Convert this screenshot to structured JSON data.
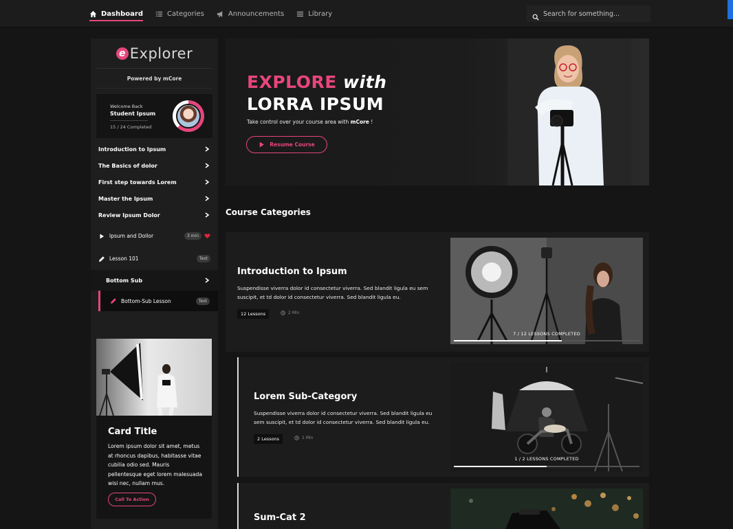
{
  "nav": {
    "items": [
      {
        "label": "Dashboard",
        "icon": "home-icon"
      },
      {
        "label": "Categories",
        "icon": "list-icon"
      },
      {
        "label": "Announcements",
        "icon": "megaphone-icon"
      },
      {
        "label": "Library",
        "icon": "library-icon"
      }
    ],
    "search_placeholder": "Search for something..."
  },
  "sidebar": {
    "logo_text": "Explorer",
    "logo_mark": "e",
    "powered_by": "Powered by mCore",
    "welcome": {
      "greeting": "Welcome Back",
      "name": "Student Ipsum",
      "progress_text": "15 / 24 Completed",
      "progress_fraction": 0.625
    },
    "menu": [
      {
        "label": "Introduction to Ipsum"
      },
      {
        "label": "The Basics of dolor"
      },
      {
        "label": "First step towards Lorem"
      },
      {
        "label": "Master the Ipsum"
      },
      {
        "label": "Review Ipsum Dolor"
      }
    ],
    "lessons": [
      {
        "label": "Ipsum and Dollor",
        "badge": "3 min",
        "icon": "play-icon",
        "favorite": true
      },
      {
        "label": "Lesson 101",
        "badge": "Text",
        "icon": "pencil-icon"
      }
    ],
    "sub": {
      "label": "Bottom Sub"
    },
    "sub_lesson": {
      "label": "Bottom-Sub Lesson",
      "badge": "Text",
      "icon": "pencil-icon"
    },
    "card": {
      "title": "Card Title",
      "body": "Lorem ipsum dolor sit amet, metus at rhoncus dapibus, habitasse vitae cubilia odio sed. Mauris pellentesque eget lorem malesuada wisi nec, nullam mus.",
      "cta": "Call To Action"
    }
  },
  "hero": {
    "title_highlight": "EXPLORE",
    "title_italic": "with",
    "title_line2": "LORRA IPSUM",
    "subtitle_pre": "Take control over your course area with",
    "subtitle_brand": "mCore",
    "subtitle_post": "!",
    "button": "Resume Course"
  },
  "section_title": "Course Categories",
  "categories": [
    {
      "title": "Introduction to Ipsum",
      "desc": "Suspendisse viverra dolor id consectetur viverra. Sed blandit ligula eu sem suscipit, et td dolor id consectetur viverra. Sed blandit ligula eu.",
      "lessons": "12 Lessons",
      "time": "2 Min",
      "progress_text": "7 / 12  LESSONS COMPLETED",
      "progress_fraction": 0.5833
    },
    {
      "title": "Lorem Sub-Category",
      "desc": "Suspendisse viverra dolor id consectetur viverra. Sed blandit ligula eu sem suscipit, et td dolor id consectetur viverra. Sed blandit ligula eu.",
      "lessons": "2 Lessons",
      "time": "1 Min",
      "progress_text": "1 / 2  LESSONS COMPLETED",
      "progress_fraction": 0.5
    },
    {
      "title": "Sum-Cat 2"
    }
  ],
  "colors": {
    "accent": "#e6467c",
    "background": "#151515",
    "panel": "#1c1c1c"
  }
}
